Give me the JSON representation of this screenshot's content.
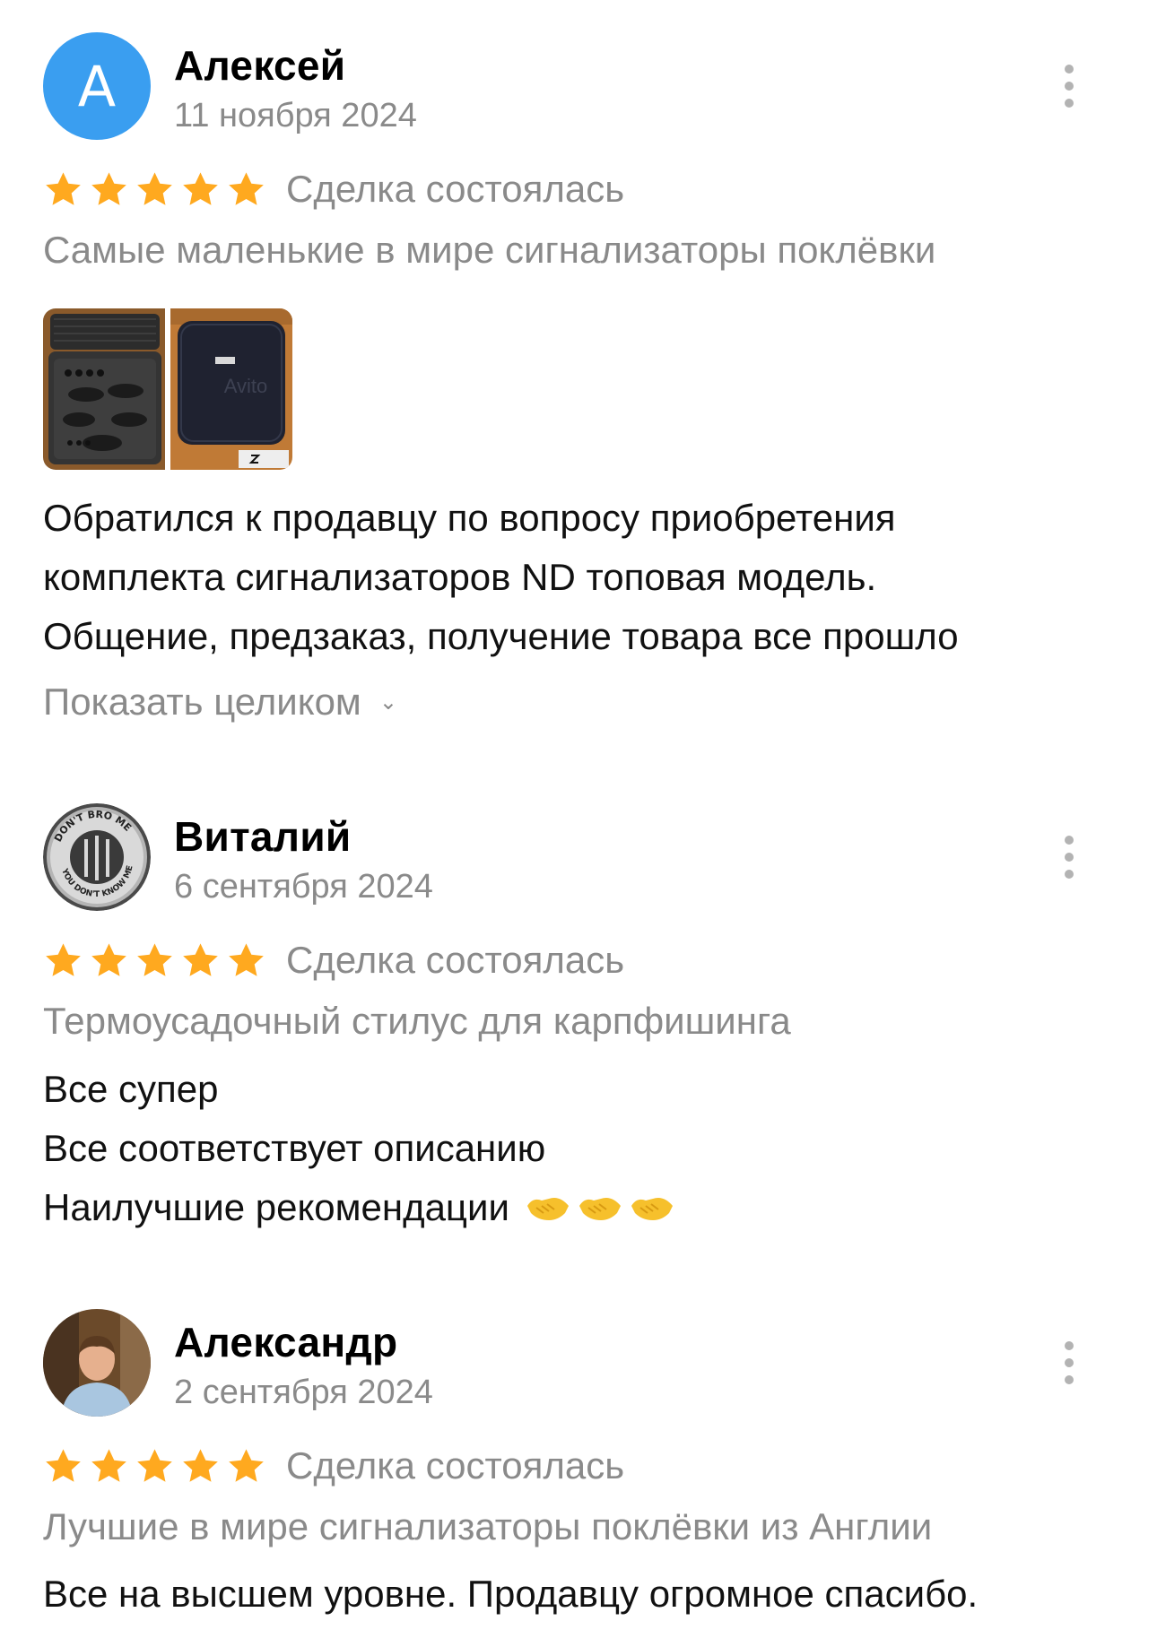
{
  "reviews": [
    {
      "author": "Алексей",
      "avatar_letter": "А",
      "avatar_type": "letter",
      "date": "11 ноября 2024",
      "rating": 5,
      "deal_status": "Сделка состоялась",
      "item_title": "Самые маленькие в мире сигнализаторы поклёвки",
      "photos": [
        "open-case-photo",
        "closed-case-photo"
      ],
      "photo_watermark": "Avito",
      "photo_brand": "ND",
      "text_lines": [
        "Обратился к продавцу по вопросу приобретения",
        "комплекта сигнализаторов ND топовая модель.",
        "Общение, предзаказ, получение товара все прошло"
      ],
      "show_more": "Показать целиком"
    },
    {
      "author": "Виталий",
      "avatar_type": "badge-image",
      "avatar_text_top": "DON'T BRO ME",
      "avatar_text_bottom": "YOU DON'T KNOW ME",
      "date": "6 сентября 2024",
      "rating": 5,
      "deal_status": "Сделка состоялась",
      "item_title": "Термоусадочный стилус для карпфишинга",
      "text_lines": [
        "Все супер",
        "Все соответствует описанию",
        "Наилучшие рекомендации"
      ],
      "emoji": [
        "handshake-emoji",
        "handshake-emoji",
        "handshake-emoji"
      ]
    },
    {
      "author": "Александр",
      "avatar_type": "photo",
      "date": "2 сентября 2024",
      "rating": 5,
      "deal_status": "Сделка состоялась",
      "item_title": "Лучшие в мире сигнализаторы поклёвки из Англии",
      "text_lines": [
        "Все на высшем уровне. Продавцу огромное спасибо."
      ]
    }
  ],
  "colors": {
    "star": "#FFA91F",
    "muted_text": "#8A8A8A",
    "avatar_blue": "#3A9EF0",
    "kebab": "#B3B3B3"
  },
  "icons": [
    "kebab-menu-icon",
    "star-icon",
    "chevron-down-icon",
    "handshake-emoji"
  ]
}
